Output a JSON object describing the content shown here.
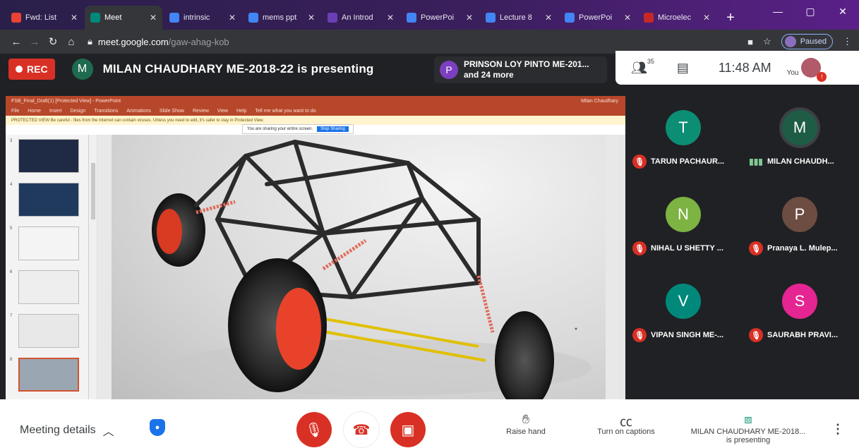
{
  "browser": {
    "tabs": [
      {
        "title": "Fwd: List",
        "color": "#ea4335",
        "active": false
      },
      {
        "title": "Meet",
        "color": "#00897b",
        "active": true
      },
      {
        "title": "intrinsic",
        "color": "#4285f4",
        "active": false
      },
      {
        "title": "mems ppt",
        "color": "#4285f4",
        "active": false
      },
      {
        "title": "An Introd",
        "color": "#6a3fb5",
        "active": false
      },
      {
        "title": "PowerPoi",
        "color": "#4285f4",
        "active": false
      },
      {
        "title": "Lecture 8",
        "color": "#4285f4",
        "active": false
      },
      {
        "title": "PowerPoi",
        "color": "#4285f4",
        "active": false
      },
      {
        "title": "Microelec",
        "color": "#c62828",
        "active": false
      }
    ],
    "new_tab": "+",
    "url_host": "meet.google.com",
    "url_path": "/gaw-ahag-kob",
    "profile_label": "Paused"
  },
  "meet": {
    "rec_label": "REC",
    "presenter_initial": "M",
    "presenting_text": "MILAN CHAUDHARY ME-2018-22 is presenting",
    "pinned_initial": "P",
    "pinned_line1": "PRINSON LOY PINTO ME-201...",
    "pinned_line2": "and 24 more",
    "participant_count": "35",
    "time": "11:48 AM",
    "you_label": "You"
  },
  "slide": {
    "window_title": "FSB_Final_Draft(1) [Protected View] - PowerPoint",
    "user_name": "Milan Chaudhary",
    "ribbon": [
      "File",
      "Home",
      "Insert",
      "Design",
      "Transitions",
      "Animations",
      "Slide Show",
      "Review",
      "View",
      "Help",
      "Tell me what you want to do"
    ],
    "protected_text": "PROTECTED VIEW  Be careful - files from the Internet can contain viruses. Unless you need to edit, it's safer to stay in Protected View.",
    "sharing_text": "You are sharing your entire screen.",
    "stop_sharing": "Stop Sharing",
    "thumb_numbers": [
      "3",
      "4",
      "5",
      "6",
      "7",
      "8"
    ]
  },
  "participants": [
    {
      "initial": "T",
      "name": "TARUN PACHAUR...",
      "color": "#0b8e73",
      "muted": true
    },
    {
      "initial": "M",
      "name": "MILAN CHAUDH...",
      "color": "#1e5c45",
      "muted": false
    },
    {
      "initial": "N",
      "name": "NIHAL U SHETTY ...",
      "color": "#7cb342",
      "muted": true
    },
    {
      "initial": "P",
      "name": "Pranaya L. Mulep...",
      "color": "#6d4c41",
      "muted": true
    },
    {
      "initial": "V",
      "name": "VIPAN SINGH ME-...",
      "color": "#00897b",
      "muted": true
    },
    {
      "initial": "S",
      "name": "SAURABH PRAVI...",
      "color": "#e52592",
      "muted": true
    }
  ],
  "bottom": {
    "meeting_details": "Meeting details",
    "raise_hand": "Raise hand",
    "captions": "Turn on captions",
    "presenting_name": "MILAN CHAUDHARY ME-2018...",
    "presenting_sub": "is presenting"
  }
}
